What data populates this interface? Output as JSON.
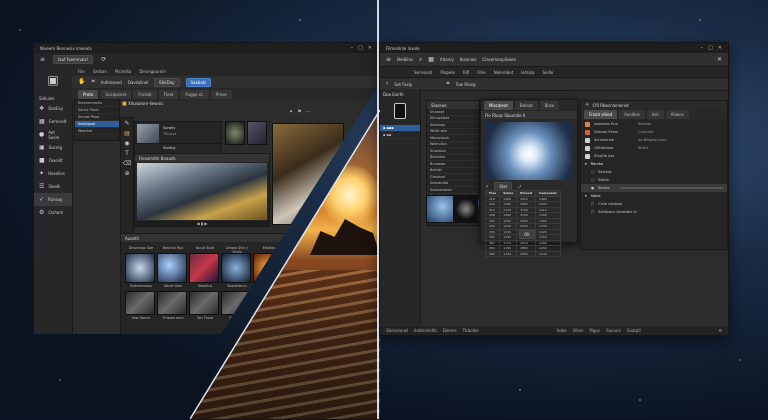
{
  "left_window": {
    "title": "Nixeem Bennesix imxeela",
    "workspace_label": "lauf fxemmaix!",
    "menu": [
      "File",
      "Sarban",
      "Plsindlia",
      "Desingaurnin"
    ],
    "toolbar": {
      "items": [
        "Indmixeed",
        "Davrblinel",
        "EbkDay"
      ],
      "right_label": "Saxbalz"
    },
    "tabs": [
      "Proto",
      "Scalpainet",
      "Frolaib",
      "Fleet",
      "Fogge st.",
      "Prese"
    ],
    "sidebar": {
      "header": "Sidiuies",
      "items": [
        {
          "label": "DezExy",
          "icon": "layers-icon"
        },
        {
          "label": "Gemiselt",
          "icon": "grid-icon"
        },
        {
          "label": "Aet Soxle",
          "icon": "circle-icon"
        },
        {
          "label": "Socnlg",
          "icon": "image-icon"
        },
        {
          "label": "Faxelilt",
          "icon": "folder-icon"
        },
        {
          "label": "Hoxelles",
          "icon": "star-icon"
        },
        {
          "label": "Sleolli",
          "icon": "sliders-icon"
        },
        {
          "label": "Ronsay",
          "icon": "check-icon"
        },
        {
          "label": "Clsham",
          "icon": "gear-icon"
        }
      ]
    },
    "file_tree": [
      "Sorenerxmeis",
      "Sence Panls",
      "Senost Paxo",
      "Sesthouel",
      "Weertes"
    ],
    "content_header": "Xllunalorn-liewnis",
    "preview_cards": [
      {
        "title": "Spratly",
        "sub": "Thlsusa"
      },
      {
        "title": "Soolbiy",
        "sub": "Tolshin"
      }
    ],
    "viewer_title": "Fiesamdm Bnauds",
    "filmstrip": {
      "header": "Auoxtli",
      "labels": [
        "Disvenloz Sae",
        "Beutlus Ripl",
        "Noult Slott",
        "Dinow Stio y Stutb",
        "Eflabks"
      ],
      "captions": [
        "Scdexmusos",
        "Sbuel Ilrac",
        "Slaullins",
        "Saioletieuu"
      ],
      "captions2": [
        "Yaw Stecul",
        "Thlewo omn",
        "Ton Flove",
        "Sbaxesis"
      ]
    }
  },
  "right_window": {
    "title": "Filmenlnle lnxole",
    "toolbar_items": [
      "Neiblias",
      "Aitoniy",
      "Ibsenies",
      "Clasemonplisaes"
    ],
    "menu": [
      "Sernsesti",
      "Plopele",
      "Rifl",
      "Frile",
      "Nelembet",
      "Ietsixa",
      "Saille"
    ],
    "sub_toolbar": [
      "Sot Fasly",
      "Tow Rlaxg"
    ],
    "folder_title": "Doa Exirlh",
    "list_panel": {
      "header": "Slaseue",
      "items": [
        "Shaaxet",
        "Elmuzebed",
        "Sboanau",
        "Whtlt aeo",
        "Morocbosh",
        "Weenilsla",
        "Snoeskal",
        "Bilemtes",
        "Buvaeae",
        "Bolidel",
        "Gimobat",
        "Aesiobubb",
        "Saoleelowen",
        "Conchollie",
        "Ahailliestlea"
      ]
    },
    "dialog": {
      "tabs": [
        "Miscaleat",
        "Beloot",
        "Blaw"
      ],
      "title": "Fle Rluas Sloumile ll",
      "badge": "Stel",
      "table_headers": [
        "Fiou",
        "Sleiss",
        "Dinoed",
        "Caoleoaiar"
      ],
      "table_rows": [
        [
          "419",
          "1400",
          "3410",
          "1480"
        ],
        [
          "416",
          "1360",
          "3260",
          "1430"
        ],
        [
          "410",
          "1310",
          "3190",
          "1410"
        ],
        [
          "408",
          "1290",
          "3150",
          "1390"
        ],
        [
          "403",
          "1250",
          "3090",
          "1360"
        ],
        [
          "399",
          "1230",
          "3030",
          "1340"
        ],
        [
          "395",
          "1210",
          "2980",
          "1320"
        ],
        [
          "391",
          "1190",
          "2950",
          "1300"
        ],
        [
          "387",
          "1170",
          "2910",
          "1280"
        ],
        [
          "384",
          "1150",
          "2880",
          "1260"
        ],
        [
          "380",
          "1130",
          "2850",
          "1240"
        ]
      ],
      "ok_label": "OK"
    },
    "properties": {
      "header": "Cfil Rbecnlxneirxit",
      "tabs": [
        "Frxint shiod",
        "Aeodles",
        "Iels",
        "Aliwns"
      ],
      "rows": [
        {
          "label": "Ixoeadan Rue",
          "value": "Stalnda",
          "color": "#e0833a"
        },
        {
          "label": "Sldeoor Eemn",
          "value": "Crarnhet",
          "color": "#d9643a"
        },
        {
          "label": "Xcrlaneraie",
          "value": "Ao Bingieg nlaro",
          "color": "#cfcfcf"
        },
        {
          "label": "Cliibtisluoe",
          "value": "Sinlhs",
          "color": "#cfcfcf"
        },
        {
          "label": "Sloyitle Asa",
          "value": "",
          "color": "#cfcfcf"
        }
      ],
      "section1": "Rarnhe",
      "section1_items": [
        "Sestsbk",
        "Sdbila",
        "Biebsn"
      ],
      "section2": "Salne",
      "section2_items": [
        "Cnlle nolzbsel",
        "Saitlbalnz Aenesble le"
      ]
    },
    "status_left": [
      "Sbenelarwl",
      "Ilebtnelntlb",
      "Dienes",
      "Tbbolee"
    ],
    "status_center": [
      "Aobe",
      "Vilien",
      "Pigus",
      "Saviurs",
      "Saatpll"
    ]
  }
}
